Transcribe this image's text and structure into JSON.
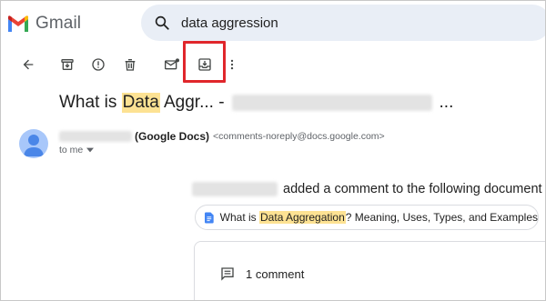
{
  "app": {
    "name": "Gmail",
    "brand_colors": {
      "red": "#ea4335",
      "blue": "#4285f4",
      "green": "#34a853",
      "yellow": "#fbbc04",
      "dark_red": "#c5221f"
    }
  },
  "search": {
    "query": "data aggression",
    "icon": "search-icon"
  },
  "toolbar": {
    "buttons": [
      {
        "name": "back-button",
        "icon": "arrow-left-icon"
      },
      {
        "name": "archive-button",
        "icon": "archive-icon"
      },
      {
        "name": "report-spam-button",
        "icon": "report-icon"
      },
      {
        "name": "delete-button",
        "icon": "trash-icon"
      },
      {
        "name": "mark-unread-button",
        "icon": "mail-unread-icon"
      },
      {
        "name": "move-to-button",
        "icon": "move-to-inbox-icon",
        "highlighted": true
      },
      {
        "name": "more-button",
        "icon": "more-vertical-icon"
      }
    ],
    "highlight_color": "#e0262b"
  },
  "email": {
    "subject": {
      "prefix": "What is ",
      "highlight": "Data",
      "suffix": " Aggr... -",
      "ellipsis": "..."
    },
    "sender": {
      "name": "(Google Docs)",
      "email": "<comments-noreply@docs.google.com>"
    },
    "recipient": "to me",
    "body": {
      "comment_text": "added a comment to the following document",
      "doc_title_prefix": "What is ",
      "doc_title_highlight": "Data Aggregation",
      "doc_title_suffix": "? Meaning, Uses, Types, and Examples",
      "comment_count": "1 comment"
    }
  }
}
